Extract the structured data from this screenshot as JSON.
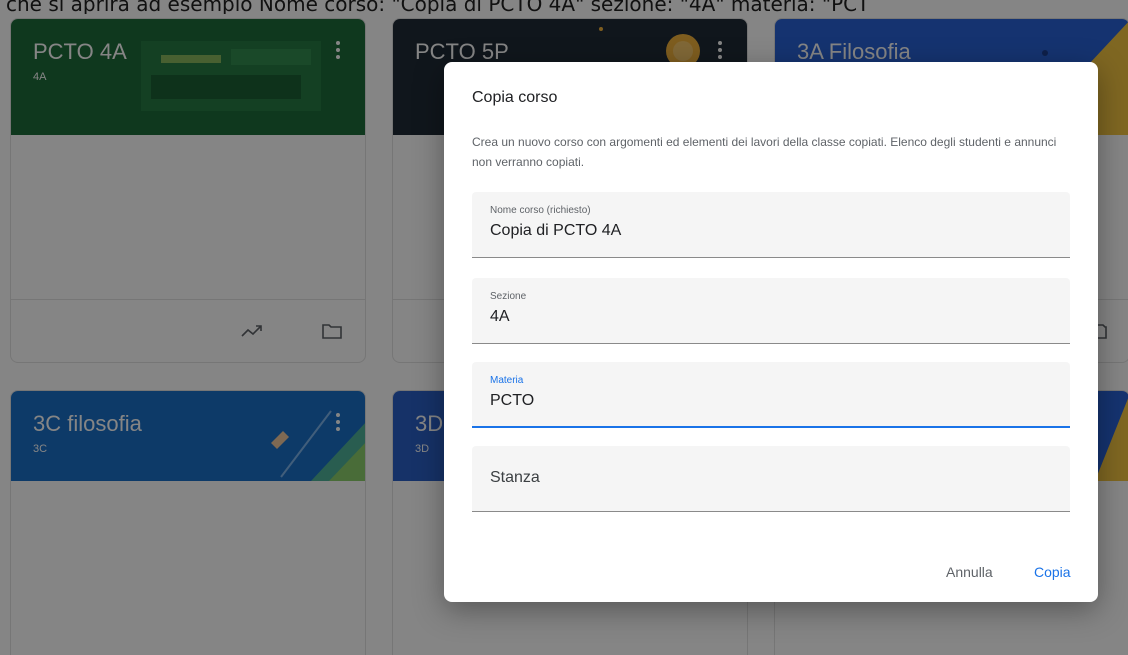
{
  "caption": "che si aprirà ad esempio Nome corso: \"Copia di PCTO 4A\" sezione: \"4A\" materia: \"PCT",
  "cards": [
    {
      "title": "PCTO 4A",
      "section": "4A",
      "color": "#1e6b3b"
    },
    {
      "title": "PCTO 5P",
      "section": "",
      "color": "#202b36"
    },
    {
      "title": "3A Filosofia",
      "section": "",
      "color": "#2962d6"
    },
    {
      "title": "3C filosofia",
      "section": "3C",
      "color": "#1a6fc7"
    },
    {
      "title": "3D",
      "section": "3D",
      "color": "#2b60c7"
    },
    {
      "title": "",
      "section": "",
      "color": "#2962d6"
    }
  ],
  "card_icons": {
    "trend": "trending-icon",
    "folder": "folder-icon",
    "more": "more-vert-icon"
  },
  "dialog": {
    "title": "Copia corso",
    "description": "Crea un nuovo corso con argomenti ed elementi dei lavori della classe copiati. Elenco degli studenti e annunci non verranno copiati.",
    "fields": [
      {
        "label": "Nome corso (richiesto)",
        "value": "Copia di PCTO 4A"
      },
      {
        "label": "Sezione",
        "value": "4A"
      },
      {
        "label": "Materia",
        "value": "PCTO"
      },
      {
        "label": "",
        "value": "Stanza"
      }
    ],
    "cancel_label": "Annulla",
    "copy_label": "Copia"
  },
  "colors": {
    "accent": "#1a73e8"
  }
}
